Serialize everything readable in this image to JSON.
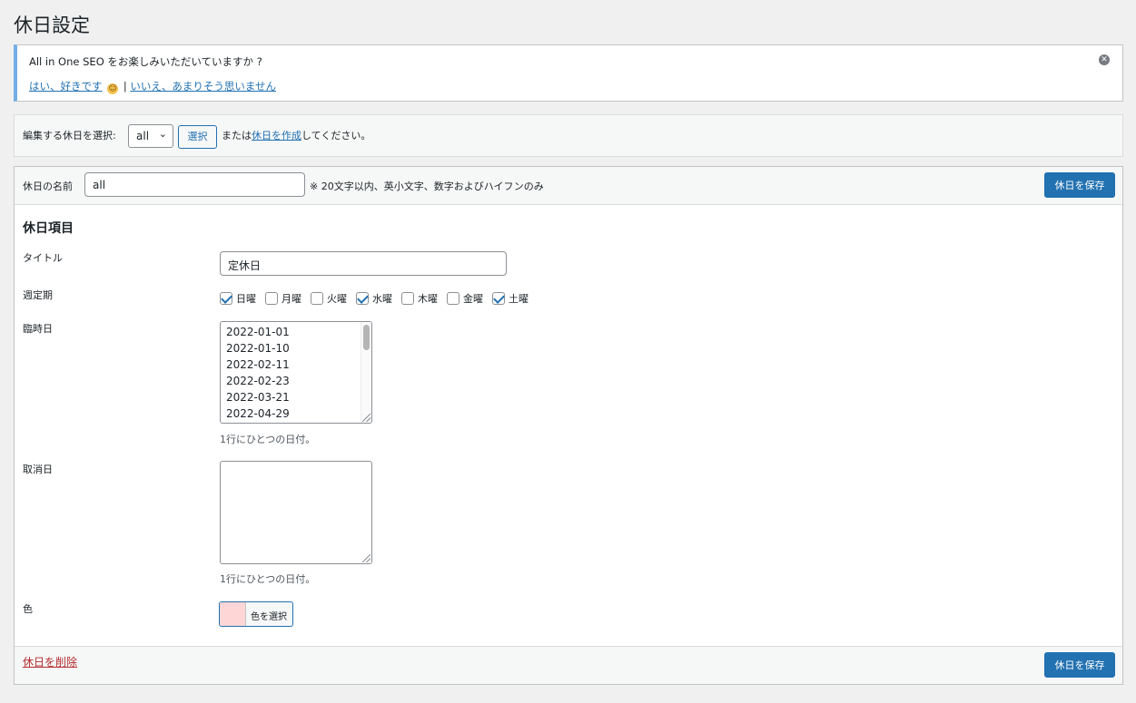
{
  "page": {
    "title": "休日設定"
  },
  "notice": {
    "message": "All in One SEO をお楽しみいただいていますか ?",
    "yes_link": "はい、好きです",
    "separator": "|",
    "no_link": "いいえ、あまりそう思いません",
    "border_color": "#72aee6"
  },
  "select_bar": {
    "label": "編集する休日を選択:",
    "selected": "all",
    "select_button": "選択",
    "or_text": "または",
    "create_link": "休日を作成",
    "suffix": "してください。"
  },
  "form": {
    "name_label": "休日の名前",
    "name_value": "all",
    "name_hint": "※ 20文字以内、英小文字、数字およびハイフンのみ",
    "save_button": "休日を保存",
    "section_title": "休日項目",
    "title_label": "タイトル",
    "title_value": "定休日",
    "weekly_label": "週定期",
    "weekdays": [
      {
        "label": "日曜",
        "checked": true
      },
      {
        "label": "月曜",
        "checked": false
      },
      {
        "label": "火曜",
        "checked": false
      },
      {
        "label": "水曜",
        "checked": true
      },
      {
        "label": "木曜",
        "checked": false
      },
      {
        "label": "金曜",
        "checked": false
      },
      {
        "label": "土曜",
        "checked": true
      }
    ],
    "temporary_label": "臨時日",
    "temporary_dates": [
      "2022-01-01",
      "2022-01-10",
      "2022-02-11",
      "2022-02-23",
      "2022-03-21",
      "2022-04-29"
    ],
    "temporary_desc": "1行にひとつの日付。",
    "cancel_label": "取消日",
    "cancel_desc": "1行にひとつの日付。",
    "color_label": "色",
    "color_button": "色を選択",
    "color_value": "#ffd6d6",
    "delete_link": "休日を削除",
    "save_button_bottom": "休日を保存"
  },
  "colors": {
    "primary": "#2271b1",
    "danger": "#b32d2e"
  }
}
